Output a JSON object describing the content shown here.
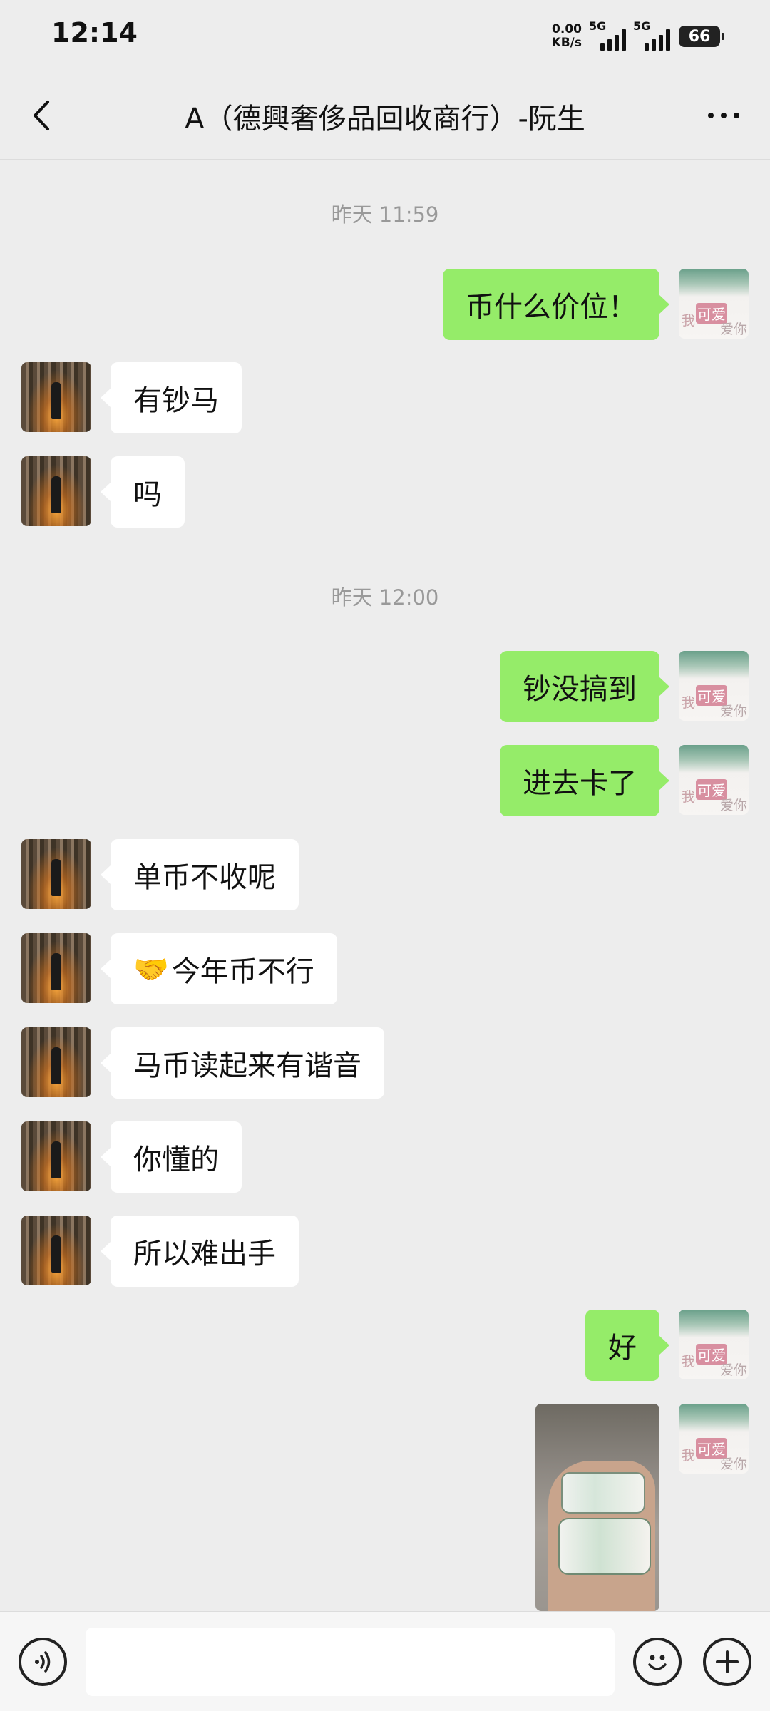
{
  "status_bar": {
    "time": "12:14",
    "net_speed_value": "0.00",
    "net_speed_unit": "KB/s",
    "signal1_label": "5G",
    "signal2_label": "5G",
    "battery": "66"
  },
  "header": {
    "title": "A（德興奢侈品回收商行）-阮生"
  },
  "timestamps": [
    "昨天 11:59",
    "昨天 12:00"
  ],
  "messages": [
    {
      "side": "self",
      "text": "币什么价位！"
    },
    {
      "side": "other",
      "text": "有钞马"
    },
    {
      "side": "other",
      "text": "吗"
    },
    {
      "side": "self",
      "text": "钞没搞到"
    },
    {
      "side": "self",
      "text": "进去卡了"
    },
    {
      "side": "other",
      "text": "单币不收呢"
    },
    {
      "side": "other",
      "emoji": "🤝",
      "text": "今年币不行"
    },
    {
      "side": "other",
      "text": "马币读起来有谐音"
    },
    {
      "side": "other",
      "text": "你懂的"
    },
    {
      "side": "other",
      "text": "所以难出手"
    },
    {
      "side": "self",
      "text": "好"
    },
    {
      "side": "self",
      "type": "image"
    }
  ],
  "self_avatar_text": {
    "line1": "我",
    "line2": "可爱",
    "line3": "爱你"
  },
  "input": {
    "value": "",
    "placeholder": ""
  },
  "colors": {
    "background": "#ededed",
    "self_bubble": "#95ec69",
    "other_bubble": "#ffffff"
  },
  "icons": [
    "back-arrow-icon",
    "more-dots-icon",
    "voice-icon",
    "emoji-icon",
    "plus-icon"
  ]
}
